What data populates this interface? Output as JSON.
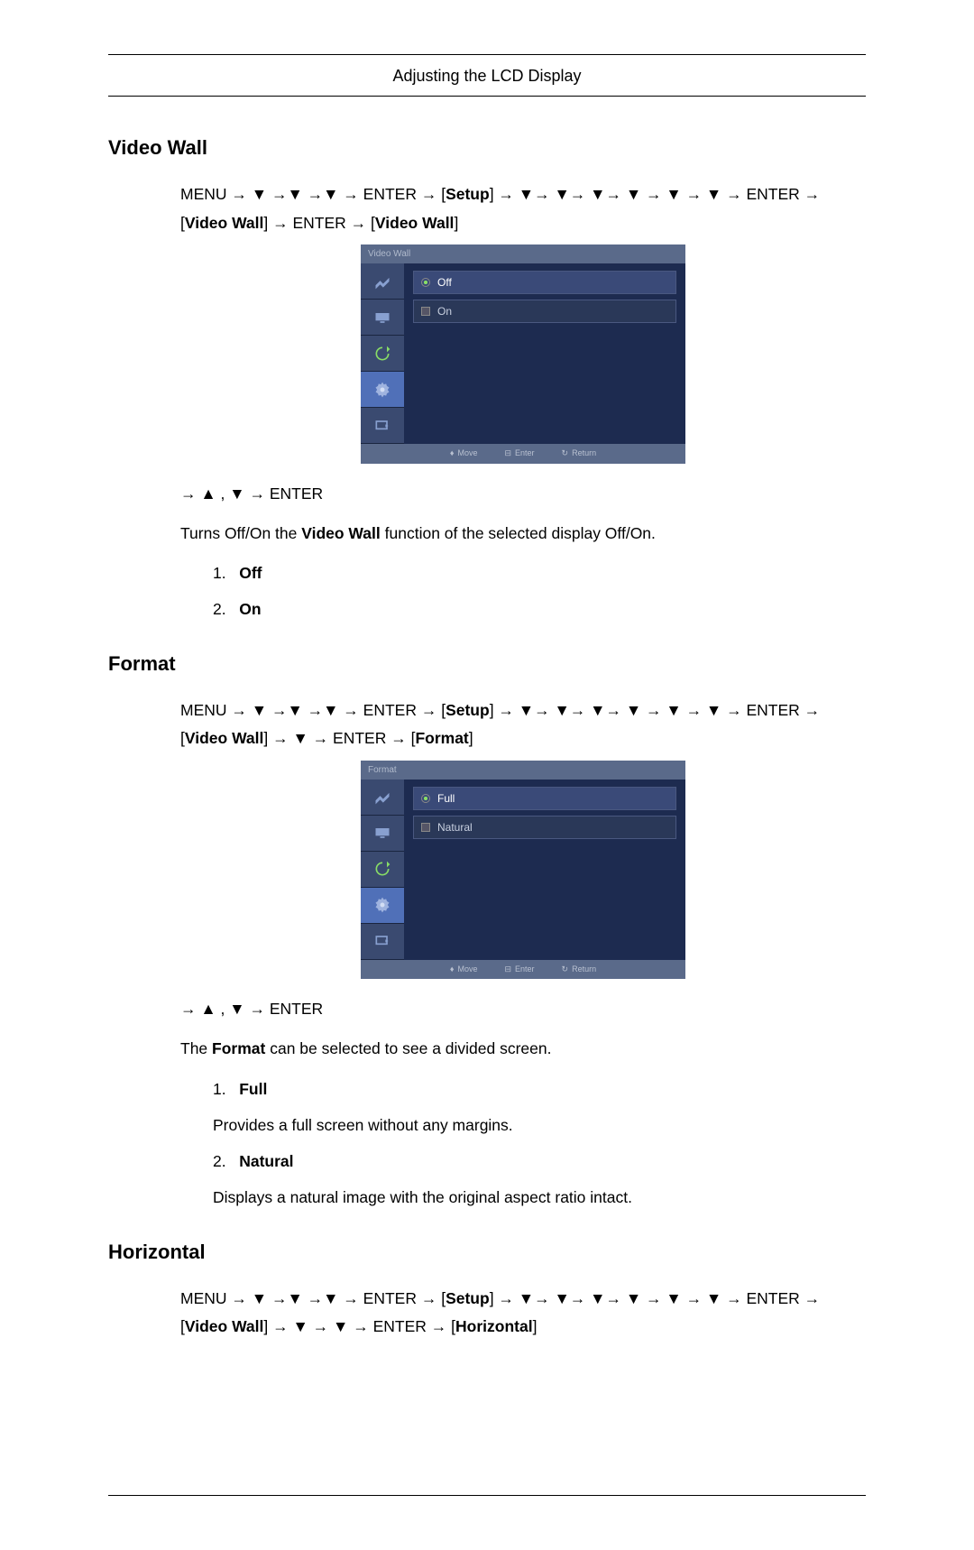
{
  "header": {
    "title": "Adjusting the LCD Display"
  },
  "videoWall": {
    "title": "Video Wall",
    "nav": {
      "menu": "MENU",
      "enter": "ENTER",
      "setup": "Setup",
      "videoWall": "Video Wall",
      "videoWall2": "Video Wall"
    },
    "osd": {
      "title": "Video Wall",
      "options": [
        {
          "label": "Off",
          "selected": true
        },
        {
          "label": "On",
          "selected": false
        }
      ],
      "footer": {
        "move": "Move",
        "enter": "Enter",
        "return": "Return"
      }
    },
    "postNav": "ENTER",
    "description": {
      "prefix": "Turns Off/On the ",
      "bold": "Video Wall",
      "suffix": " function of the selected display Off/On."
    },
    "list": [
      {
        "num": "1.",
        "label": "Off"
      },
      {
        "num": "2.",
        "label": "On"
      }
    ]
  },
  "format": {
    "title": "Format",
    "nav": {
      "menu": "MENU",
      "enter": "ENTER",
      "setup": "Setup",
      "videoWall": "Video Wall",
      "format": "Format"
    },
    "osd": {
      "title": "Format",
      "options": [
        {
          "label": "Full",
          "selected": true
        },
        {
          "label": "Natural",
          "selected": false
        }
      ],
      "footer": {
        "move": "Move",
        "enter": "Enter",
        "return": "Return"
      }
    },
    "postNav": "ENTER",
    "description": {
      "prefix": "The ",
      "bold": "Format",
      "suffix": " can be selected to see a divided screen."
    },
    "list": [
      {
        "num": "1.",
        "label": "Full",
        "desc": "Provides a full screen without any margins."
      },
      {
        "num": "2.",
        "label": "Natural",
        "desc": "Displays a natural image with the original aspect ratio intact."
      }
    ]
  },
  "horizontal": {
    "title": "Horizontal",
    "nav": {
      "menu": "MENU",
      "enter": "ENTER",
      "setup": "Setup",
      "videoWall": "Video Wall",
      "horizontal": "Horizontal"
    }
  }
}
